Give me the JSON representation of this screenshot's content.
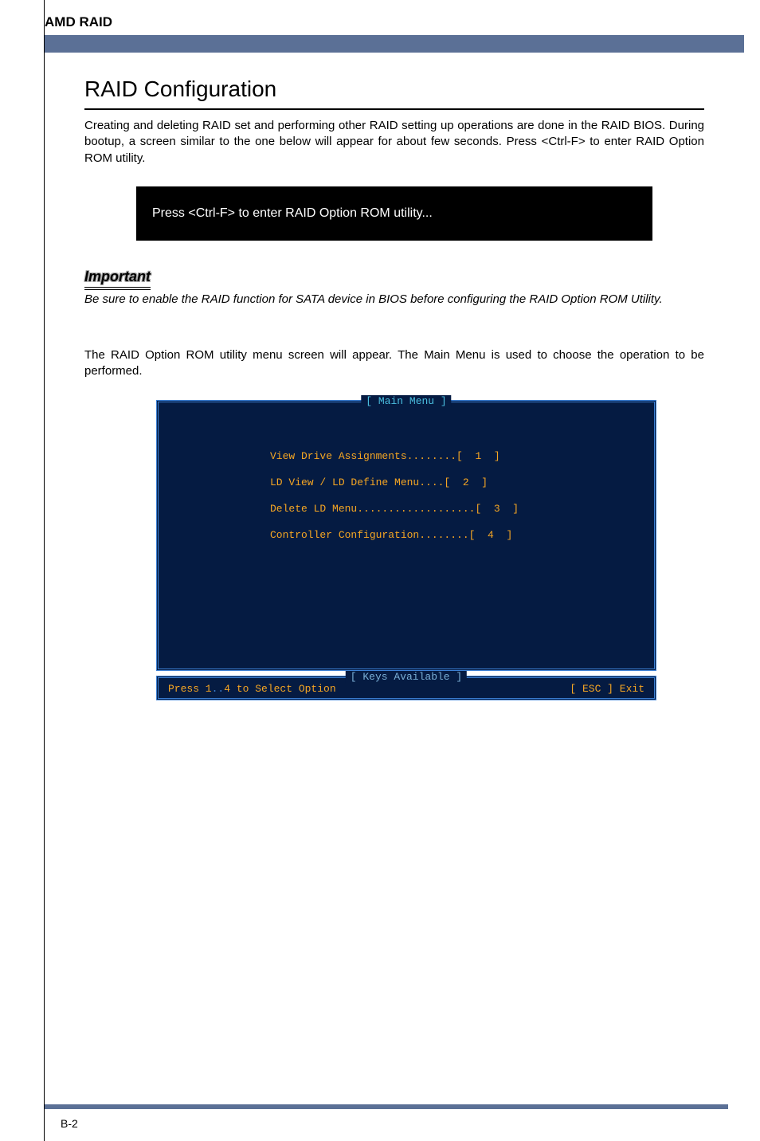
{
  "header": {
    "title": "AMD RAID"
  },
  "section": {
    "heading": "RAID Configuration",
    "intro": "Creating and deleting RAID set and performing other RAID setting up operations are done in the RAID BIOS. During bootup, a screen similar to the one below will appear for about few seconds. Press <Ctrl-F> to enter RAID Option ROM utility.",
    "prompt_text": "Press <Ctrl-F> to enter RAID Option ROM utility...",
    "important_label": "Important",
    "important_text": "Be sure to enable the RAID function for SATA device in BIOS before configuring the RAID Option ROM Utility.",
    "paragraph2": "The RAID Option ROM utility menu screen will appear. The Main Menu is used to choose the operation to be performed."
  },
  "bios": {
    "main_menu_title": "[ Main Menu ]",
    "items": [
      "View Drive Assignments........[  1  ]",
      "LD View / LD Define Menu....[  2  ]",
      "Delete LD Menu...................[  3  ]",
      "Controller Configuration........[  4  ]"
    ],
    "keys_title": "[ Keys Available ]",
    "keys_left_prefix": "Press 1",
    "keys_left_dots": "..",
    "keys_left_suffix": "4 to Select Option",
    "keys_right": "[ ESC ]  Exit"
  },
  "footer": {
    "page_num": "B-2"
  }
}
